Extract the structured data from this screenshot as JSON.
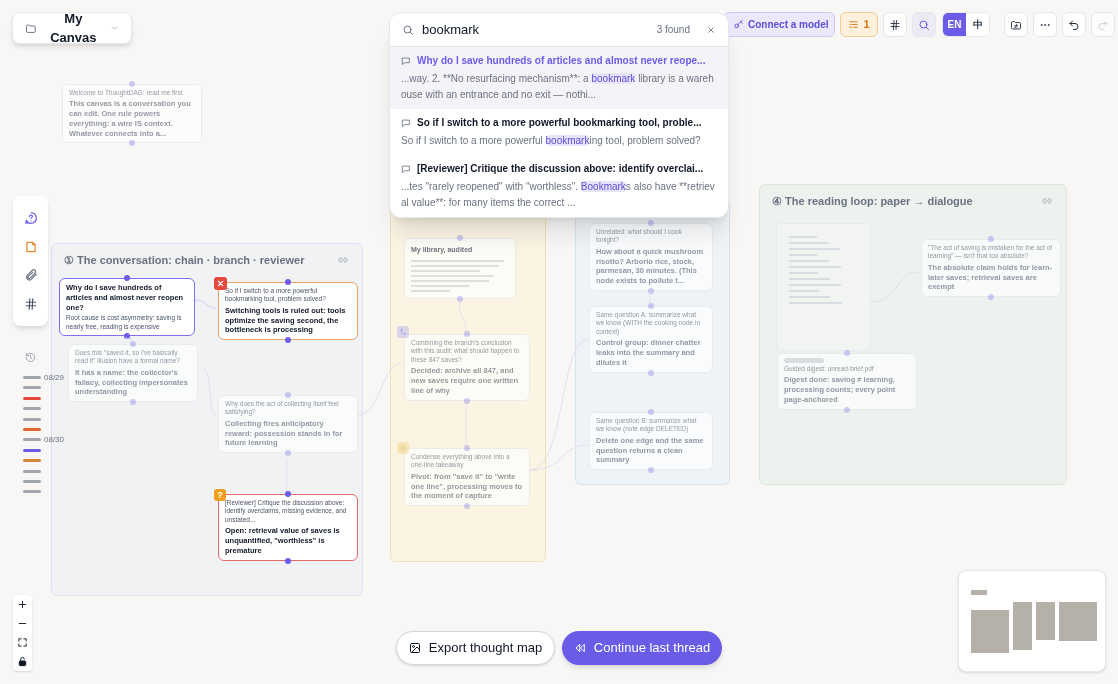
{
  "canvas_menu": {
    "label": "My Canvas"
  },
  "search": {
    "query": "bookmark",
    "count": "3 found",
    "results": [
      {
        "title": "Why do I save hundreds of articles and almost never reope...",
        "selected": true,
        "snippet": [
          {
            "text": "...way. 2. **No resurfacing mechanism**: a ",
            "match": false
          },
          {
            "text": "bookmark",
            "match": true
          },
          {
            "text": " library is a warehouse with an entrance and no exit — nothi...",
            "match": false
          }
        ]
      },
      {
        "title": "So if I switch to a more powerful bookmarking tool, proble...",
        "selected": false,
        "snippet": [
          {
            "text": "So if I switch to a more powerful ",
            "match": false
          },
          {
            "text": "bookmark",
            "match": true
          },
          {
            "text": "ing tool, problem solved?",
            "match": false
          }
        ]
      },
      {
        "title": "[Reviewer] Critique the discussion above: identify overclai...",
        "selected": false,
        "snippet": [
          {
            "text": "...tes \"rarely reopened\" with \"worthless\". ",
            "match": false
          },
          {
            "text": "Bookmark",
            "match": true
          },
          {
            "text": "s also have **retrieval value**: for many items the correct ...",
            "match": false
          }
        ]
      }
    ]
  },
  "toolbar": {
    "connect_label": "Connect a model",
    "queue_count": "1",
    "search_on": true,
    "redo_disabled": true,
    "language": [
      {
        "label": "EN",
        "selected": true
      },
      {
        "label": "中",
        "selected": false
      }
    ]
  },
  "timeline": [
    {
      "color": "#a3a6ad",
      "date": "08/29"
    },
    {
      "color": "#a3a6ad"
    },
    {
      "color": "#e5483d"
    },
    {
      "color": "#a3a6ad"
    },
    {
      "color": "#a3a6ad"
    },
    {
      "color": "#e0662f"
    },
    {
      "color": "#a3a6ad",
      "date": "08/30"
    },
    {
      "color": "#6b5ce7"
    },
    {
      "color": "#d4883a"
    },
    {
      "color": "#a3a6ad"
    },
    {
      "color": "#a3a6ad"
    },
    {
      "color": "#a3a6ad"
    }
  ],
  "free_nodes": [
    {
      "kind": "message",
      "dimmed": true,
      "prompt": "Welcome to ThoughtDAG: read me first",
      "answer": "This canvas is a conversation you can edit. One rule powers everything: a wire IS context. Whatever connects into a..."
    }
  ],
  "groups": [
    {
      "title": "① The conversation: chain · branch · reviewer",
      "color": "#f1f2f4",
      "nodes": [
        {
          "kind": "message",
          "dimmed": false,
          "color": "#7c6ff0",
          "answer": "Why do I save hundreds of articles and almost never reopen one?",
          "note": "Root cause is cost asymmetry: saving is nearly free, reading is expensive"
        },
        {
          "kind": "message",
          "dimmed": false,
          "color": "#e8a064",
          "badge": {
            "kind": "error"
          },
          "prompt": "So if I switch to a more powerful bookmarking tool, problem solved?",
          "answer": "Switching tools is ruled out: tools optimize the saving second, the bottleneck is processing"
        },
        {
          "kind": "message",
          "dimmed": true,
          "prompt": "Does this \"saved it, so I've basically read it\" illusion have a formal name?",
          "answer": "It has a name: the collector's fallacy, collecting impersonates understanding"
        },
        {
          "kind": "message",
          "dimmed": true,
          "prompt": "Why does the act of collecting itself feel satisfying?",
          "answer": "Collecting fires anticipatory reward: possession stands in for future learning"
        },
        {
          "kind": "message",
          "dimmed": false,
          "color": "#e06a6a",
          "badge": {
            "kind": "question",
            "text": "?"
          },
          "prompt": "[Reviewer] Critique the discussion above: identify overclaims, missing evidence, and unstated...",
          "answer": "Open: retrieval value of saves is unquantified, \"worthless\" is premature"
        }
      ]
    },
    {
      "color": "#fbf4e3",
      "nodes": [
        {
          "kind": "note",
          "dimmed": true,
          "answer": "My library, audited"
        },
        {
          "kind": "message",
          "dimmed": true,
          "badge": {
            "kind": "merge"
          },
          "prompt": "Combining the branch's conclusion with this audit: what should happen to these 847 saves?",
          "answer": "Decided: archive all 847, and new saves require one written line of why"
        },
        {
          "kind": "message",
          "dimmed": true,
          "badge": {
            "kind": "condense"
          },
          "prompt": "Condense everything above into a one-line takeaway",
          "answer": "Pivot: from \"save it\" to \"write one line\", processing moves to the moment of capture"
        }
      ]
    },
    {
      "color": "#eef3f7",
      "nodes": [
        {
          "kind": "message",
          "dimmed": true,
          "prompt": "Unrelated: what should I cook tonight?",
          "answer": "How about a quick mushroom risotto? Arborio rice, stock, parmesan, 30 minutes. (This node exists to pollute t..."
        },
        {
          "kind": "message",
          "dimmed": true,
          "prompt": "Same question A: summarize what we know (WITH the cooking node in context)",
          "answer": "Control group: dinner chatter leaks into the summary and dilutes it"
        },
        {
          "kind": "message",
          "dimmed": true,
          "prompt": "Same question B: summarize what we know (note edge DELETED)",
          "answer": "Delete one edge and the same question returns a clean summary"
        }
      ]
    },
    {
      "title": "④ The reading loop: paper → dialogue",
      "color": "#eef2ef",
      "nodes": [
        {
          "kind": "document",
          "dimmed": true
        },
        {
          "kind": "digest",
          "dimmed": true,
          "prompt": "Guided digest: unread-brief.pdf",
          "answer": "Digest done: saving ≠ learning, processing counts; every point page-anchored"
        },
        {
          "kind": "message",
          "dimmed": true,
          "prompt": "\"The act of saving is mistaken for the act of learning\" — isn't that too absolute?",
          "answer": "The absolute claim holds for learn-later saves; retrieval saves are exempt"
        }
      ]
    }
  ],
  "actions": [
    {
      "label": "Export thought map",
      "primary": false
    },
    {
      "label": "Continue last thread",
      "primary": true
    }
  ]
}
